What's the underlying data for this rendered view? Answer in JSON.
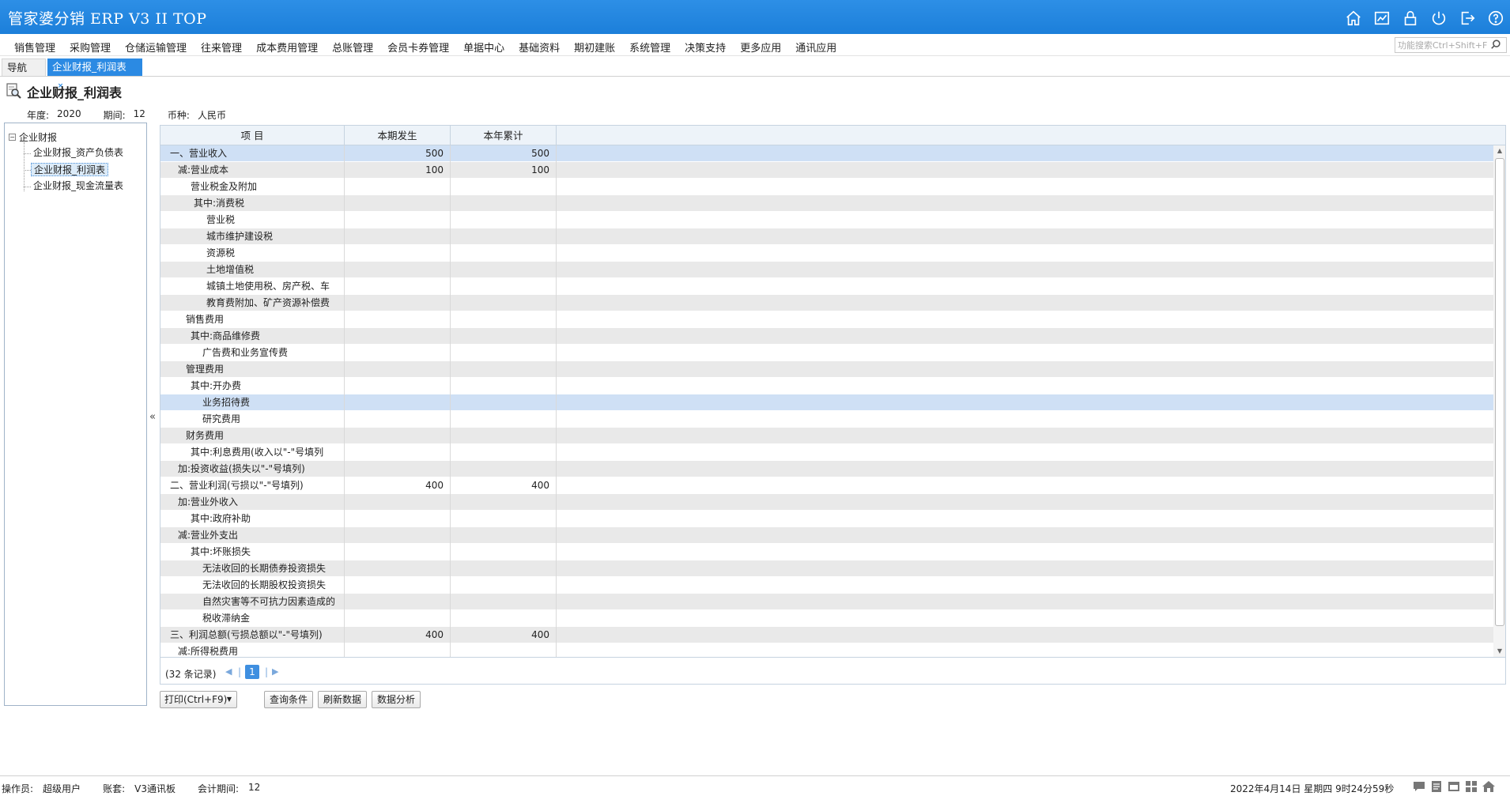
{
  "app": {
    "title": "管家婆分销 ERP V3 II TOP"
  },
  "top_icons": [
    "home-icon",
    "chart-icon",
    "lock-icon",
    "power-icon",
    "exit-icon",
    "help-icon"
  ],
  "menu": [
    "销售管理",
    "采购管理",
    "仓储运输管理",
    "往来管理",
    "成本费用管理",
    "总账管理",
    "会员卡券管理",
    "单据中心",
    "基础资料",
    "期初建账",
    "系统管理",
    "决策支持",
    "更多应用",
    "通讯应用"
  ],
  "search": {
    "placeholder": "功能搜索Ctrl+Shift+F"
  },
  "tabs": {
    "nav": "导航",
    "active": "企业财报_利润表"
  },
  "page": {
    "title": "企业财报_利润表",
    "year_label": "年度:",
    "year": "2020",
    "period_label": "期间:",
    "period": "12",
    "currency_label": "币种:",
    "currency": "人民币"
  },
  "tree": {
    "root": "企业财报",
    "children": [
      "企业财报_资产负债表",
      "企业财报_利润表",
      "企业财报_现金流量表"
    ],
    "selected_index": 1
  },
  "grid": {
    "columns": [
      "项 目",
      "本期发生",
      "本年累计"
    ],
    "rows": [
      {
        "item": "一、营业收入",
        "current": "500",
        "ytd": "500",
        "indent": 12
      },
      {
        "item": "减:营业成本",
        "current": "100",
        "ytd": "100",
        "indent": 22
      },
      {
        "item": "营业税金及附加",
        "current": "",
        "ytd": "",
        "indent": 38
      },
      {
        "item": "其中:消费税",
        "current": "",
        "ytd": "",
        "indent": 42
      },
      {
        "item": "营业税",
        "current": "",
        "ytd": "",
        "indent": 58
      },
      {
        "item": "城市维护建设税",
        "current": "",
        "ytd": "",
        "indent": 58
      },
      {
        "item": "资源税",
        "current": "",
        "ytd": "",
        "indent": 58
      },
      {
        "item": "土地增值税",
        "current": "",
        "ytd": "",
        "indent": 58
      },
      {
        "item": "城镇土地使用税、房产税、车",
        "current": "",
        "ytd": "",
        "indent": 58
      },
      {
        "item": "教育费附加、矿产资源补偿费",
        "current": "",
        "ytd": "",
        "indent": 58
      },
      {
        "item": "销售费用",
        "current": "",
        "ytd": "",
        "indent": 32
      },
      {
        "item": "其中:商品维修费",
        "current": "",
        "ytd": "",
        "indent": 38
      },
      {
        "item": "广告费和业务宣传费",
        "current": "",
        "ytd": "",
        "indent": 53
      },
      {
        "item": "管理费用",
        "current": "",
        "ytd": "",
        "indent": 32
      },
      {
        "item": "其中:开办费",
        "current": "",
        "ytd": "",
        "indent": 38
      },
      {
        "item": "业务招待费",
        "current": "",
        "ytd": "",
        "indent": 53
      },
      {
        "item": "研究费用",
        "current": "",
        "ytd": "",
        "indent": 53
      },
      {
        "item": "财务费用",
        "current": "",
        "ytd": "",
        "indent": 32
      },
      {
        "item": "其中:利息费用(收入以\"-\"号填列",
        "current": "",
        "ytd": "",
        "indent": 38
      },
      {
        "item": "加:投资收益(损失以\"-\"号填列)",
        "current": "",
        "ytd": "",
        "indent": 22
      },
      {
        "item": "二、营业利润(亏损以\"-\"号填列)",
        "current": "400",
        "ytd": "400",
        "indent": 12
      },
      {
        "item": "加:营业外收入",
        "current": "",
        "ytd": "",
        "indent": 22
      },
      {
        "item": "其中:政府补助",
        "current": "",
        "ytd": "",
        "indent": 38
      },
      {
        "item": "减:营业外支出",
        "current": "",
        "ytd": "",
        "indent": 22
      },
      {
        "item": "其中:坏账损失",
        "current": "",
        "ytd": "",
        "indent": 38
      },
      {
        "item": "无法收回的长期债券投资损失",
        "current": "",
        "ytd": "",
        "indent": 53
      },
      {
        "item": "无法收回的长期股权投资损失",
        "current": "",
        "ytd": "",
        "indent": 53
      },
      {
        "item": "自然灾害等不可抗力因素造成的",
        "current": "",
        "ytd": "",
        "indent": 53
      },
      {
        "item": "税收滞纳金",
        "current": "",
        "ytd": "",
        "indent": 53
      },
      {
        "item": "三、利润总额(亏损总额以\"-\"号填列)",
        "current": "400",
        "ytd": "400",
        "indent": 12
      },
      {
        "item": "减:所得税费用",
        "current": "",
        "ytd": "",
        "indent": 22
      }
    ],
    "selected_row": 0,
    "hover_row": 15
  },
  "pager": {
    "records": "(32 条记录)",
    "page": "1"
  },
  "buttons": {
    "print": "打印(Ctrl+F9)",
    "query": "查询条件",
    "refresh": "刷新数据",
    "analyze": "数据分析"
  },
  "status": {
    "operator_label": "操作员:",
    "operator": "超级用户",
    "account_label": "账套:",
    "account": "V3通讯板",
    "period_label": "会计期间:",
    "period": "12",
    "datetime": "2022年4月14日 星期四 9时24分59秒"
  },
  "status_icons": [
    "message-icon",
    "notes-icon",
    "window-icon",
    "grid-icon",
    "home-small-icon"
  ],
  "colors": {
    "header": "#1c7fda",
    "tab_active": "#2b8ae3",
    "row_selected": "#cfe0f5",
    "row_alt": "#e9e9e9"
  }
}
